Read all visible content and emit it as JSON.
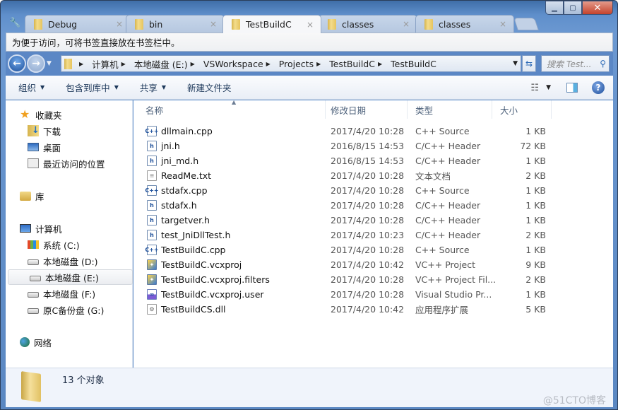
{
  "window": {
    "tabs": [
      {
        "label": "Debug",
        "active": false
      },
      {
        "label": "bin",
        "active": false
      },
      {
        "label": "TestBuildC",
        "active": true
      },
      {
        "label": "classes",
        "active": false
      },
      {
        "label": "classes",
        "active": false
      }
    ],
    "tab_close_glyph": "×",
    "controls": {
      "minimize": "▁",
      "maximize": "▢",
      "close": "✕"
    }
  },
  "bookmark_bar": {
    "text": "为便于访问，可将书签直接放在书签栏中。"
  },
  "navigation": {
    "back_glyph": "←",
    "forward_glyph": "→",
    "breadcrumb": [
      "计算机",
      "本地磁盘 (E:)",
      "VSWorkspace",
      "Projects",
      "TestBuildC",
      "TestBuildC"
    ],
    "search_placeholder": "搜索 Test...",
    "refresh_glyph": "⇆"
  },
  "toolbar": {
    "organize": "组织",
    "include_in_library": "包含到库中",
    "share": "共享",
    "new_folder": "新建文件夹"
  },
  "sidebar": {
    "favorites": {
      "label": "收藏夹",
      "items": [
        "下载",
        "桌面",
        "最近访问的位置"
      ]
    },
    "libraries": {
      "label": "库"
    },
    "computer": {
      "label": "计算机",
      "items": [
        "系统 (C:)",
        "本地磁盘 (D:)",
        "本地磁盘 (E:)",
        "本地磁盘 (F:)",
        "原C备份盘 (G:)"
      ],
      "selected": "本地磁盘 (E:)"
    },
    "network": {
      "label": "网络"
    }
  },
  "columns": {
    "name": "名称",
    "date": "修改日期",
    "type": "类型",
    "size": "大小"
  },
  "files": [
    {
      "name": "dllmain.cpp",
      "icon": "cpp",
      "date": "2017/4/20 10:28",
      "type": "C++ Source",
      "size": "1 KB"
    },
    {
      "name": "jni.h",
      "icon": "h",
      "date": "2016/8/15 14:53",
      "type": "C/C++ Header",
      "size": "72 KB"
    },
    {
      "name": "jni_md.h",
      "icon": "h",
      "date": "2016/8/15 14:53",
      "type": "C/C++ Header",
      "size": "1 KB"
    },
    {
      "name": "ReadMe.txt",
      "icon": "txt",
      "date": "2017/4/20 10:28",
      "type": "文本文档",
      "size": "2 KB"
    },
    {
      "name": "stdafx.cpp",
      "icon": "cpp",
      "date": "2017/4/20 10:28",
      "type": "C++ Source",
      "size": "1 KB"
    },
    {
      "name": "stdafx.h",
      "icon": "h",
      "date": "2017/4/20 10:28",
      "type": "C/C++ Header",
      "size": "1 KB"
    },
    {
      "name": "targetver.h",
      "icon": "h",
      "date": "2017/4/20 10:28",
      "type": "C/C++ Header",
      "size": "1 KB"
    },
    {
      "name": "test_JniDllTest.h",
      "icon": "h",
      "date": "2017/4/20 10:23",
      "type": "C/C++ Header",
      "size": "2 KB"
    },
    {
      "name": "TestBuildC.cpp",
      "icon": "cpp",
      "date": "2017/4/20 10:28",
      "type": "C++ Source",
      "size": "1 KB"
    },
    {
      "name": "TestBuildC.vcxproj",
      "icon": "proj",
      "date": "2017/4/20 10:42",
      "type": "VC++ Project",
      "size": "9 KB"
    },
    {
      "name": "TestBuildC.vcxproj.filters",
      "icon": "proj",
      "date": "2017/4/20 10:28",
      "type": "VC++ Project Fil...",
      "size": "2 KB"
    },
    {
      "name": "TestBuildC.vcxproj.user",
      "icon": "user",
      "date": "2017/4/20 10:28",
      "type": "Visual Studio Pr...",
      "size": "1 KB"
    },
    {
      "name": "TestBuildCS.dll",
      "icon": "dll",
      "date": "2017/4/20 10:42",
      "type": "应用程序扩展",
      "size": "5 KB"
    }
  ],
  "status": {
    "count_text": "13 个对象"
  },
  "watermark": "@51CTO博客"
}
